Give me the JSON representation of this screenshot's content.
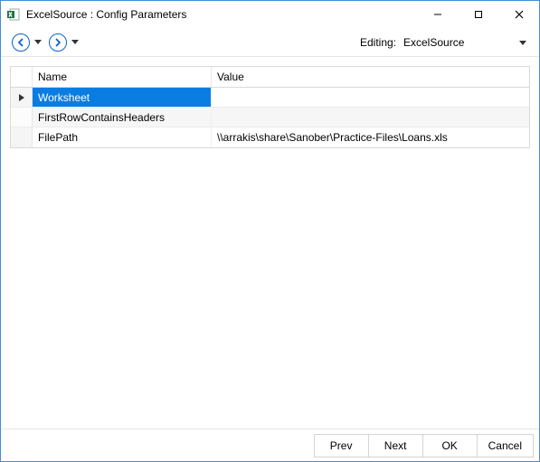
{
  "window": {
    "title": "ExcelSource : Config Parameters"
  },
  "navbar": {
    "editing_label": "Editing:",
    "editing_value": "ExcelSource"
  },
  "grid": {
    "headers": {
      "name": "Name",
      "value": "Value"
    },
    "rows": [
      {
        "name": "Worksheet",
        "value": "",
        "selected": true
      },
      {
        "name": "FirstRowContainsHeaders",
        "value": ""
      },
      {
        "name": "FilePath",
        "value": "\\\\arrakis\\share\\Sanober\\Practice-Files\\Loans.xls"
      }
    ]
  },
  "footer": {
    "prev": "Prev",
    "next": "Next",
    "ok": "OK",
    "cancel": "Cancel"
  }
}
